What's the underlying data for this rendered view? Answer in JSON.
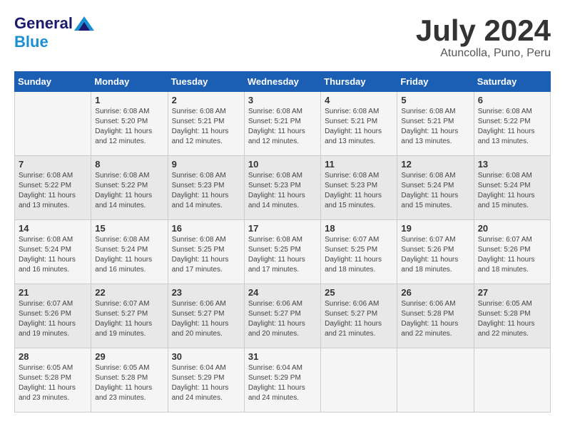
{
  "header": {
    "logo_general": "General",
    "logo_blue": "Blue",
    "month_year": "July 2024",
    "location": "Atuncolla, Puno, Peru"
  },
  "weekdays": [
    "Sunday",
    "Monday",
    "Tuesday",
    "Wednesday",
    "Thursday",
    "Friday",
    "Saturday"
  ],
  "weeks": [
    [
      {
        "day": "",
        "sunrise": "",
        "sunset": "",
        "daylight": ""
      },
      {
        "day": "1",
        "sunrise": "Sunrise: 6:08 AM",
        "sunset": "Sunset: 5:20 PM",
        "daylight": "Daylight: 11 hours and 12 minutes."
      },
      {
        "day": "2",
        "sunrise": "Sunrise: 6:08 AM",
        "sunset": "Sunset: 5:21 PM",
        "daylight": "Daylight: 11 hours and 12 minutes."
      },
      {
        "day": "3",
        "sunrise": "Sunrise: 6:08 AM",
        "sunset": "Sunset: 5:21 PM",
        "daylight": "Daylight: 11 hours and 12 minutes."
      },
      {
        "day": "4",
        "sunrise": "Sunrise: 6:08 AM",
        "sunset": "Sunset: 5:21 PM",
        "daylight": "Daylight: 11 hours and 13 minutes."
      },
      {
        "day": "5",
        "sunrise": "Sunrise: 6:08 AM",
        "sunset": "Sunset: 5:21 PM",
        "daylight": "Daylight: 11 hours and 13 minutes."
      },
      {
        "day": "6",
        "sunrise": "Sunrise: 6:08 AM",
        "sunset": "Sunset: 5:22 PM",
        "daylight": "Daylight: 11 hours and 13 minutes."
      }
    ],
    [
      {
        "day": "7",
        "sunrise": "Sunrise: 6:08 AM",
        "sunset": "Sunset: 5:22 PM",
        "daylight": "Daylight: 11 hours and 13 minutes."
      },
      {
        "day": "8",
        "sunrise": "Sunrise: 6:08 AM",
        "sunset": "Sunset: 5:22 PM",
        "daylight": "Daylight: 11 hours and 14 minutes."
      },
      {
        "day": "9",
        "sunrise": "Sunrise: 6:08 AM",
        "sunset": "Sunset: 5:23 PM",
        "daylight": "Daylight: 11 hours and 14 minutes."
      },
      {
        "day": "10",
        "sunrise": "Sunrise: 6:08 AM",
        "sunset": "Sunset: 5:23 PM",
        "daylight": "Daylight: 11 hours and 14 minutes."
      },
      {
        "day": "11",
        "sunrise": "Sunrise: 6:08 AM",
        "sunset": "Sunset: 5:23 PM",
        "daylight": "Daylight: 11 hours and 15 minutes."
      },
      {
        "day": "12",
        "sunrise": "Sunrise: 6:08 AM",
        "sunset": "Sunset: 5:24 PM",
        "daylight": "Daylight: 11 hours and 15 minutes."
      },
      {
        "day": "13",
        "sunrise": "Sunrise: 6:08 AM",
        "sunset": "Sunset: 5:24 PM",
        "daylight": "Daylight: 11 hours and 15 minutes."
      }
    ],
    [
      {
        "day": "14",
        "sunrise": "Sunrise: 6:08 AM",
        "sunset": "Sunset: 5:24 PM",
        "daylight": "Daylight: 11 hours and 16 minutes."
      },
      {
        "day": "15",
        "sunrise": "Sunrise: 6:08 AM",
        "sunset": "Sunset: 5:24 PM",
        "daylight": "Daylight: 11 hours and 16 minutes."
      },
      {
        "day": "16",
        "sunrise": "Sunrise: 6:08 AM",
        "sunset": "Sunset: 5:25 PM",
        "daylight": "Daylight: 11 hours and 17 minutes."
      },
      {
        "day": "17",
        "sunrise": "Sunrise: 6:08 AM",
        "sunset": "Sunset: 5:25 PM",
        "daylight": "Daylight: 11 hours and 17 minutes."
      },
      {
        "day": "18",
        "sunrise": "Sunrise: 6:07 AM",
        "sunset": "Sunset: 5:25 PM",
        "daylight": "Daylight: 11 hours and 18 minutes."
      },
      {
        "day": "19",
        "sunrise": "Sunrise: 6:07 AM",
        "sunset": "Sunset: 5:26 PM",
        "daylight": "Daylight: 11 hours and 18 minutes."
      },
      {
        "day": "20",
        "sunrise": "Sunrise: 6:07 AM",
        "sunset": "Sunset: 5:26 PM",
        "daylight": "Daylight: 11 hours and 18 minutes."
      }
    ],
    [
      {
        "day": "21",
        "sunrise": "Sunrise: 6:07 AM",
        "sunset": "Sunset: 5:26 PM",
        "daylight": "Daylight: 11 hours and 19 minutes."
      },
      {
        "day": "22",
        "sunrise": "Sunrise: 6:07 AM",
        "sunset": "Sunset: 5:27 PM",
        "daylight": "Daylight: 11 hours and 19 minutes."
      },
      {
        "day": "23",
        "sunrise": "Sunrise: 6:06 AM",
        "sunset": "Sunset: 5:27 PM",
        "daylight": "Daylight: 11 hours and 20 minutes."
      },
      {
        "day": "24",
        "sunrise": "Sunrise: 6:06 AM",
        "sunset": "Sunset: 5:27 PM",
        "daylight": "Daylight: 11 hours and 20 minutes."
      },
      {
        "day": "25",
        "sunrise": "Sunrise: 6:06 AM",
        "sunset": "Sunset: 5:27 PM",
        "daylight": "Daylight: 11 hours and 21 minutes."
      },
      {
        "day": "26",
        "sunrise": "Sunrise: 6:06 AM",
        "sunset": "Sunset: 5:28 PM",
        "daylight": "Daylight: 11 hours and 22 minutes."
      },
      {
        "day": "27",
        "sunrise": "Sunrise: 6:05 AM",
        "sunset": "Sunset: 5:28 PM",
        "daylight": "Daylight: 11 hours and 22 minutes."
      }
    ],
    [
      {
        "day": "28",
        "sunrise": "Sunrise: 6:05 AM",
        "sunset": "Sunset: 5:28 PM",
        "daylight": "Daylight: 11 hours and 23 minutes."
      },
      {
        "day": "29",
        "sunrise": "Sunrise: 6:05 AM",
        "sunset": "Sunset: 5:28 PM",
        "daylight": "Daylight: 11 hours and 23 minutes."
      },
      {
        "day": "30",
        "sunrise": "Sunrise: 6:04 AM",
        "sunset": "Sunset: 5:29 PM",
        "daylight": "Daylight: 11 hours and 24 minutes."
      },
      {
        "day": "31",
        "sunrise": "Sunrise: 6:04 AM",
        "sunset": "Sunset: 5:29 PM",
        "daylight": "Daylight: 11 hours and 24 minutes."
      },
      {
        "day": "",
        "sunrise": "",
        "sunset": "",
        "daylight": ""
      },
      {
        "day": "",
        "sunrise": "",
        "sunset": "",
        "daylight": ""
      },
      {
        "day": "",
        "sunrise": "",
        "sunset": "",
        "daylight": ""
      }
    ]
  ]
}
